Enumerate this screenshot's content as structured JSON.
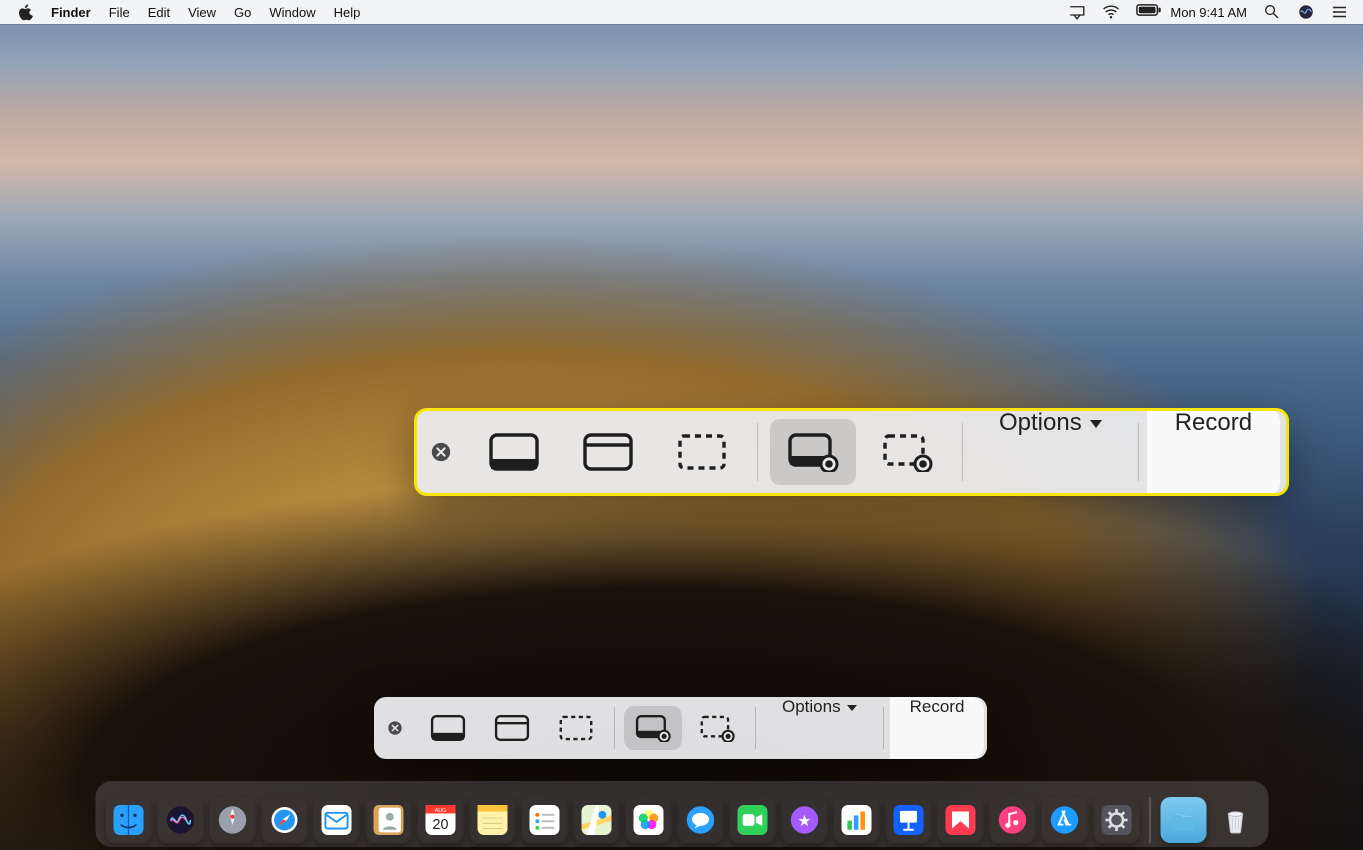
{
  "menubar": {
    "app": "Finder",
    "items": [
      "File",
      "Edit",
      "View",
      "Go",
      "Window",
      "Help"
    ],
    "clock": "Mon 9:41 AM",
    "status_icons": [
      "airplay-icon",
      "wifi-icon",
      "battery-icon"
    ],
    "right_icons": [
      "spotlight-icon",
      "siri-icon",
      "notification-center-icon"
    ]
  },
  "screenshot_toolbar": {
    "options_label": "Options",
    "action_label": "Record",
    "tools": [
      {
        "name": "capture-entire-screen",
        "selected": false
      },
      {
        "name": "capture-window",
        "selected": false
      },
      {
        "name": "capture-selection",
        "selected": false
      },
      {
        "name": "record-entire-screen",
        "selected": true
      },
      {
        "name": "record-selection",
        "selected": false
      }
    ]
  },
  "annotation": {
    "highlight_color": "#f6e600"
  },
  "dock": {
    "apps": [
      {
        "name": "finder",
        "bg": "linear-gradient(#38b3ff,#0f6bd6)"
      },
      {
        "name": "siri",
        "bg": "radial-gradient(circle at 40% 35%,#6d7cff,#12122a)"
      },
      {
        "name": "launchpad",
        "bg": "linear-gradient(#c7c7cf,#8a8a94)"
      },
      {
        "name": "safari",
        "bg": "linear-gradient(#fefefe,#d9d9df)"
      },
      {
        "name": "mail",
        "bg": "linear-gradient(#fff,#e4e4ea)"
      },
      {
        "name": "contacts",
        "bg": "linear-gradient(#e7c085,#c98f45)"
      },
      {
        "name": "calendar",
        "bg": "linear-gradient(#ffffff,#f1f1f4)"
      },
      {
        "name": "notes",
        "bg": "linear-gradient(#fff7b0,#f7dd57)"
      },
      {
        "name": "reminders",
        "bg": "linear-gradient(#ffffff,#ececf0)"
      },
      {
        "name": "maps",
        "bg": "linear-gradient(#d8f0c3,#f5e8b4)"
      },
      {
        "name": "photos",
        "bg": "linear-gradient(#ffffff,#ececf0)"
      },
      {
        "name": "messages",
        "bg": "linear-gradient(#3db3ff,#0a73d6)"
      },
      {
        "name": "facetime",
        "bg": "linear-gradient(#3bdc63,#149a37)"
      },
      {
        "name": "itunes-store",
        "bg": "linear-gradient(#b463ff,#7a1fe0)"
      },
      {
        "name": "numbers-or-stocks",
        "bg": "linear-gradient(#ffffff,#ececf0)"
      },
      {
        "name": "keynote",
        "bg": "linear-gradient(#1f6bff,#0d3aa9)"
      },
      {
        "name": "news",
        "bg": "linear-gradient(#ff4b63,#d2102b)"
      },
      {
        "name": "music",
        "bg": "linear-gradient(#ff5fa8,#ff2d6d)"
      },
      {
        "name": "app-store",
        "bg": "linear-gradient(#2aa6ff,#0a6fe0)"
      },
      {
        "name": "system-preferences",
        "bg": "linear-gradient(#6b6b73,#2e2e34)"
      }
    ],
    "right": [
      {
        "name": "downloads-folder"
      },
      {
        "name": "trash"
      }
    ],
    "calendar_day": "20",
    "calendar_month": "AUG"
  }
}
